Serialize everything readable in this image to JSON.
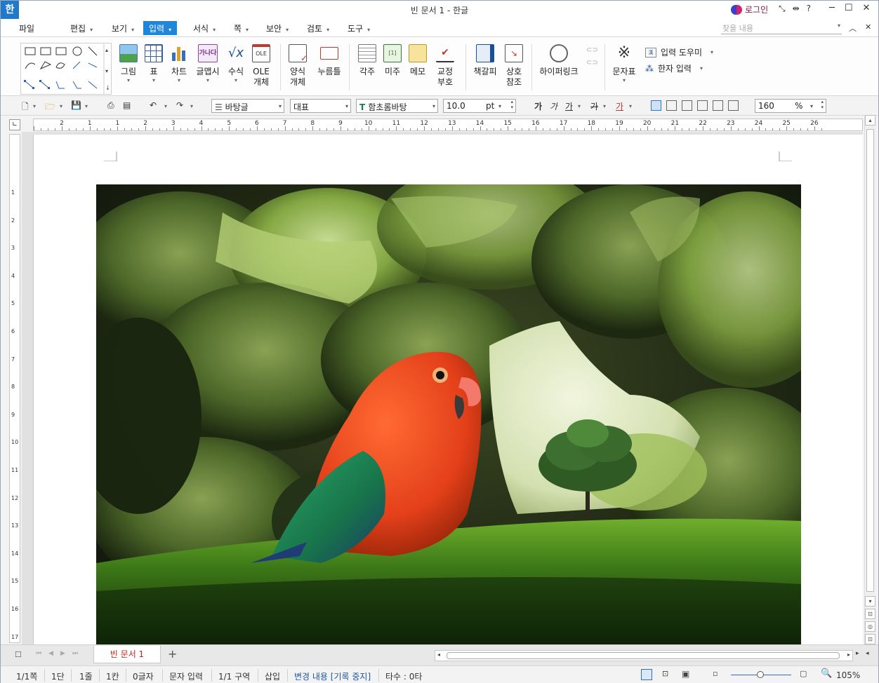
{
  "window": {
    "title": "빈 문서 1 - 한글",
    "app_icon": "한",
    "login_label": "로그인"
  },
  "menu": {
    "file": "파일",
    "items": [
      "편집",
      "보기",
      "입력",
      "서식",
      "쪽",
      "보안",
      "검토",
      "도구"
    ],
    "active": "입력",
    "search_placeholder": "찾을 내용"
  },
  "ribbon": {
    "buttons": [
      {
        "label": "그림",
        "icon": "picture-icon"
      },
      {
        "label": "표",
        "icon": "table-icon"
      },
      {
        "label": "차트",
        "icon": "chart-icon"
      },
      {
        "label": "글맵시",
        "icon": "text-art-icon"
      },
      {
        "label": "수식",
        "icon": "equation-icon"
      },
      {
        "label": "OLE\n개체",
        "icon": "ole-icon"
      },
      {
        "label": "양식\n개체",
        "icon": "form-object-icon"
      },
      {
        "label": "누름틀",
        "icon": "field-icon"
      },
      {
        "label": "각주",
        "icon": "footnote-icon"
      },
      {
        "label": "미주",
        "icon": "endnote-icon"
      },
      {
        "label": "메모",
        "icon": "memo-icon"
      },
      {
        "label": "교정\n부호",
        "icon": "proofreading-icon"
      },
      {
        "label": "책갈피",
        "icon": "bookmark-icon"
      },
      {
        "label": "상호\n참조",
        "icon": "cross-reference-icon"
      },
      {
        "label": "하이퍼링크",
        "icon": "hyperlink-icon"
      },
      {
        "label": "문자표",
        "icon": "symbol-icon"
      }
    ],
    "input_helper": "입력 도우미",
    "hanja_input": "한자 입력"
  },
  "format": {
    "style": "바탕글",
    "lang": "대표",
    "font": "함초롬바탕",
    "size": "10.0",
    "size_unit": "pt",
    "zoom": "160",
    "zoom_unit": "%",
    "bold": "가",
    "italic": "가",
    "underline": "가",
    "strike": "가",
    "color": "가"
  },
  "ruler": {
    "h_numbers": [
      "2",
      "1",
      "1",
      "2",
      "3",
      "4",
      "5",
      "6",
      "7",
      "8",
      "9",
      "10",
      "11",
      "12",
      "13",
      "14",
      "15",
      "16",
      "17",
      "18",
      "19",
      "20",
      "21",
      "22",
      "23",
      "24",
      "25",
      "26"
    ],
    "v_numbers": [
      "1",
      "2",
      "3",
      "4",
      "5",
      "6",
      "7",
      "8",
      "9",
      "10",
      "11",
      "12",
      "13",
      "14",
      "15",
      "16",
      "17"
    ]
  },
  "tabs": {
    "doc_tab": "빈 문서 1"
  },
  "status": {
    "page": "1/1쪽",
    "column": "1단",
    "line": "1줄",
    "col": "1칸",
    "chars": "0글자",
    "mode": "문자 입력",
    "section": "1/1 구역",
    "insert": "삽입",
    "track": "변경 내용 [기록 중지]",
    "typing": "타수 : 0타",
    "zoom": "105%"
  }
}
